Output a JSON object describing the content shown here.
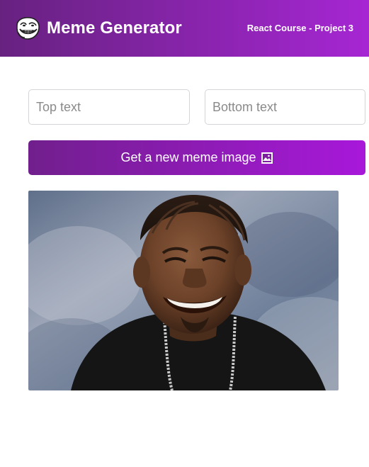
{
  "header": {
    "title": "Meme Generator",
    "project_label": "React Course - Project 3",
    "logo_icon": "troll-face-icon",
    "gradient_start": "#672280",
    "gradient_end": "#A626D3"
  },
  "form": {
    "top_text_placeholder": "Top text",
    "top_text_value": "",
    "bottom_text_placeholder": "Bottom text",
    "bottom_text_value": "",
    "button_label": "Get a new meme image",
    "button_icon": "framed-picture-icon"
  },
  "meme": {
    "image_semantic": "meme-photo"
  }
}
